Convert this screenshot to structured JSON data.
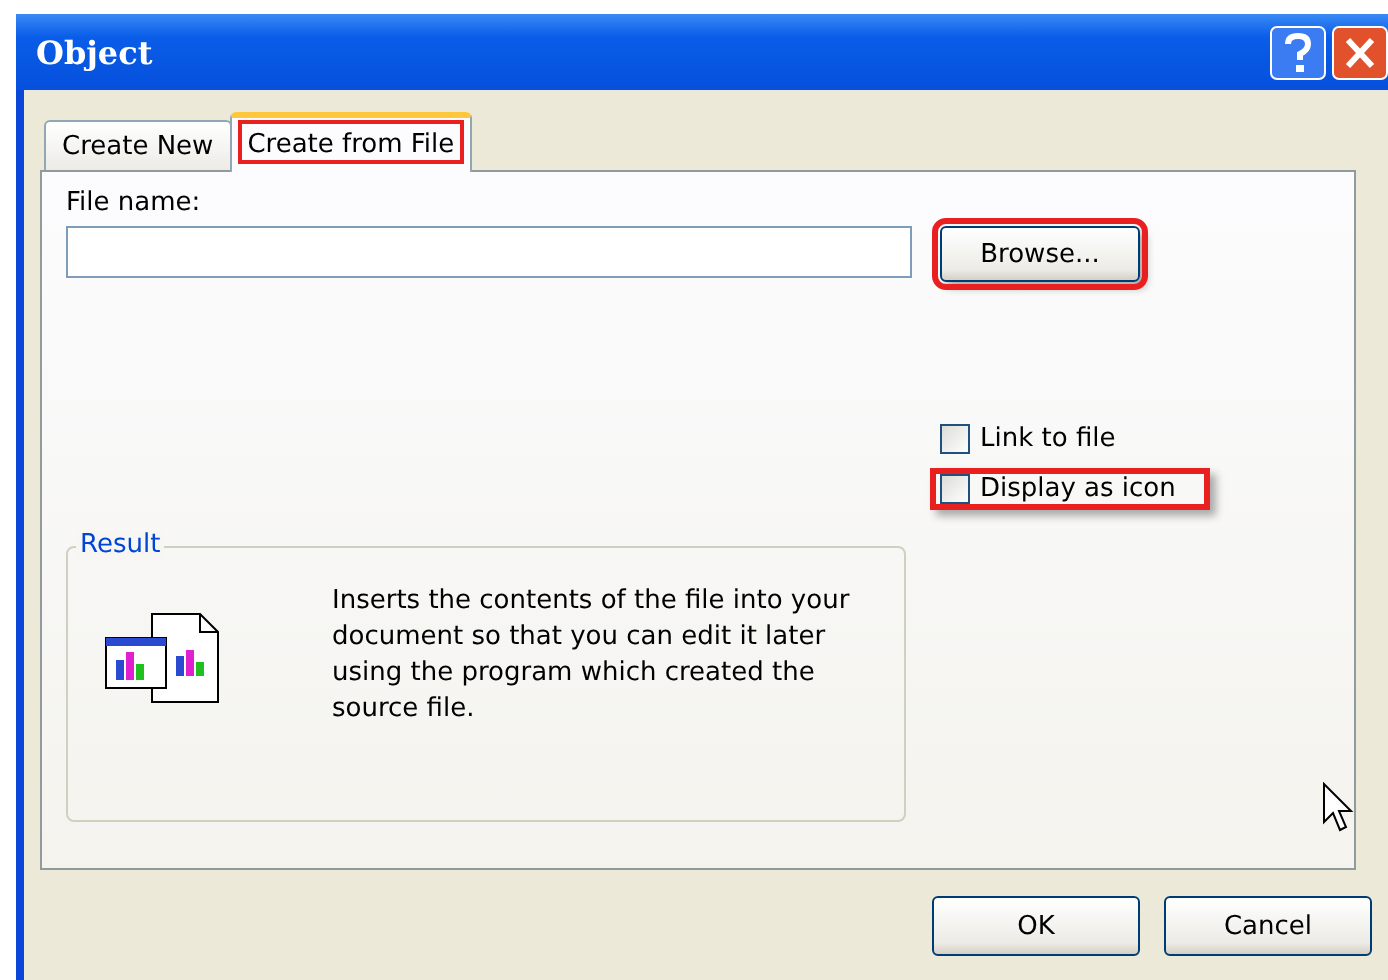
{
  "window": {
    "title": "Object"
  },
  "tabs": [
    {
      "label": "Create New",
      "selected": false,
      "highlighted": false
    },
    {
      "label": "Create from File",
      "selected": true,
      "highlighted": true
    }
  ],
  "file_name": {
    "label": "File name:"
  },
  "browse_button": {
    "label": "Browse...",
    "highlighted": true
  },
  "options": [
    {
      "label": "Link to file",
      "checked": false,
      "highlighted": false
    },
    {
      "label": "Display as icon",
      "checked": false,
      "highlighted": true
    }
  ],
  "result": {
    "title": "Result",
    "text": "Inserts the contents of the file into your document so that you can edit it later using the program which created the source file."
  },
  "buttons": [
    "OK",
    "Cancel"
  ]
}
